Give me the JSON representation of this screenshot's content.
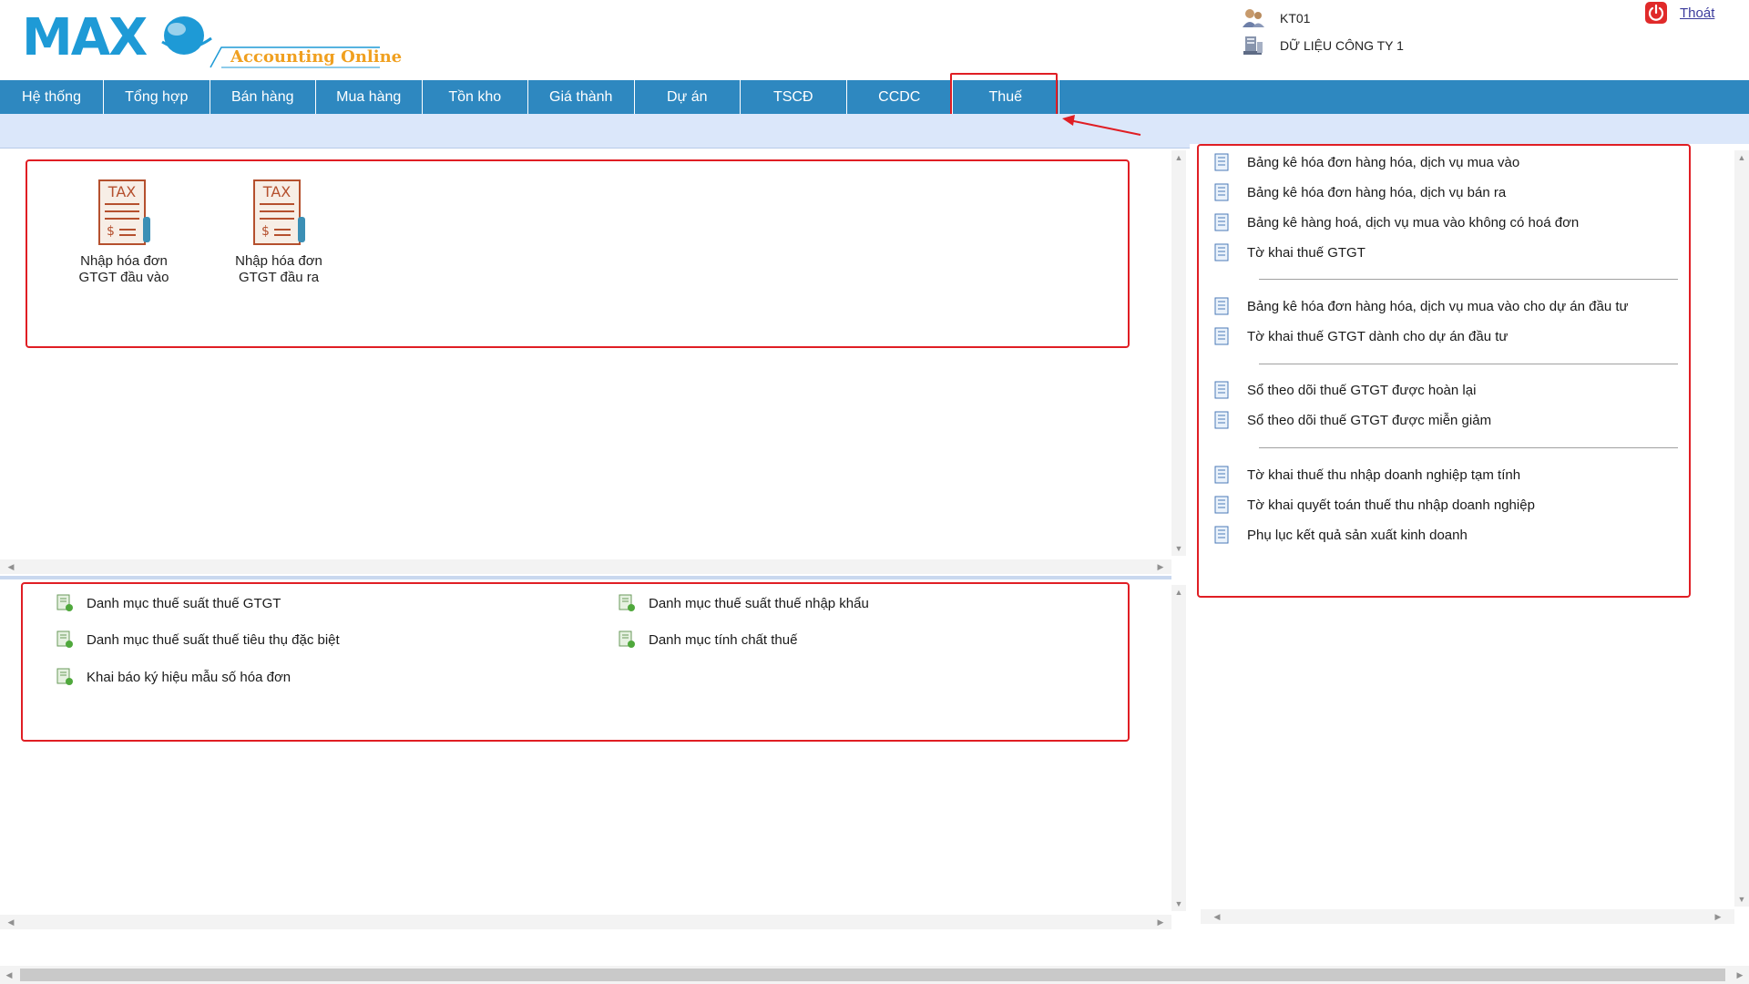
{
  "app": {
    "logo_text": "MAX",
    "logo_subtitle": "Accounting Online",
    "user_code": "KT01",
    "company": "DỮ LIỆU CÔNG TY 1",
    "logout_label": "Thoát"
  },
  "nav": {
    "items": [
      "Hệ thống",
      "Tổng hợp",
      "Bán hàng",
      "Mua hàng",
      "Tồn kho",
      "Giá thành",
      "Dự án",
      "TSCĐ",
      "CCDC",
      "Thuế"
    ],
    "active": "Thuế"
  },
  "tiles": [
    {
      "icon_text": "TAX",
      "label_line1": "Nhập hóa đơn",
      "label_line2": "GTGT đầu vào"
    },
    {
      "icon_text": "TAX",
      "label_line1": "Nhập hóa đơn",
      "label_line2": "GTGT đầu ra"
    }
  ],
  "catalogs": [
    "Danh mục thuế suất thuế GTGT",
    "Danh mục thuế suất thuế nhập khẩu",
    "Danh mục thuế suất thuế tiêu thụ đặc biệt",
    "Danh mục tính chất thuế",
    "Khai báo ký hiệu mẫu số hóa đơn"
  ],
  "reports": {
    "group1": [
      "Bảng kê hóa đơn hàng hóa, dịch vụ mua vào",
      "Bảng kê hóa đơn hàng hóa, dịch vụ bán ra",
      "Bảng kê hàng hoá, dịch vụ mua vào không có hoá đơn",
      "Tờ khai thuế GTGT"
    ],
    "group2": [
      "Bảng kê hóa đơn hàng hóa, dịch vụ mua vào cho dự án đầu tư",
      "Tờ khai thuế GTGT dành cho dự án đầu tư"
    ],
    "group3": [
      "Sổ theo dõi thuế GTGT được hoàn lại",
      "Sổ theo dõi thuế GTGT được miễn giảm"
    ],
    "group4": [
      "Tờ khai thuế thu nhập doanh nghiệp tạm tính",
      "Tờ khai quyết toán thuế thu nhập doanh nghiệp",
      "Phụ lục kết quả sản xuất kinh doanh"
    ]
  },
  "colors": {
    "nav_bg": "#2e88c0",
    "subbar_bg": "#dbe7fa",
    "highlight": "#e01e24",
    "logo_blue": "#1e9ad6",
    "logo_orange": "#f0a020"
  }
}
